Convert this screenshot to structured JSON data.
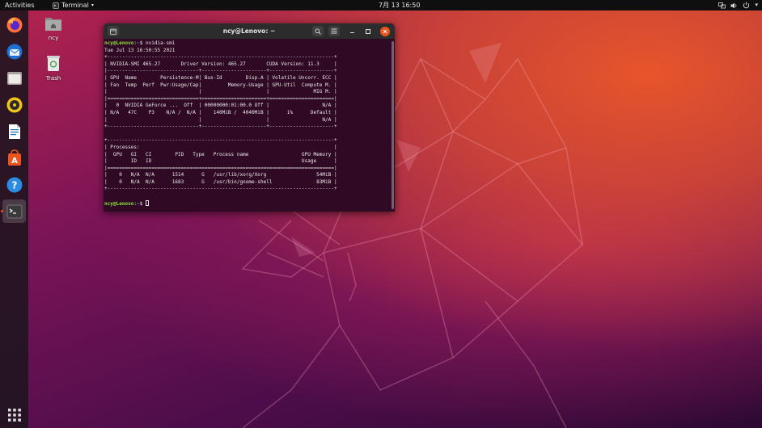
{
  "topbar": {
    "activities": "Activities",
    "app_menu": "Terminal",
    "clock": "7月 13  16:50"
  },
  "dock": {
    "items": [
      "firefox-icon",
      "thunderbird-icon",
      "files-icon",
      "rhythmbox-icon",
      "libreoffice-writer-icon",
      "ubuntu-software-icon",
      "help-icon",
      "terminal-icon"
    ]
  },
  "desktop": {
    "home_label": "ncy",
    "trash_label": "Trash"
  },
  "terminal": {
    "title": "ncy@Lenovo: ~",
    "prompt_user": "ncy@Lenovo",
    "prompt_path": "~",
    "command": "nvidia-smi",
    "output": "Tue Jul 13 16:50:55 2021       \n+-----------------------------------------------------------------------------+\n| NVIDIA-SMI 465.27       Driver Version: 465.27       CUDA Version: 11.3     |\n|-------------------------------+----------------------+----------------------+\n| GPU  Name        Persistence-M| Bus-Id        Disp.A | Volatile Uncorr. ECC |\n| Fan  Temp  Perf  Pwr:Usage/Cap|         Memory-Usage | GPU-Util  Compute M. |\n|                               |                      |               MIG M. |\n|===============================+======================+======================|\n|   0  NVIDIA GeForce ...  Off  | 00000000:01:00.0 Off |                  N/A |\n| N/A   47C    P3    N/A /  N/A |    140MiB /  4040MiB |      1%      Default |\n|                               |                      |                  N/A |\n+-------------------------------+----------------------+----------------------+\n                                                                               \n+-----------------------------------------------------------------------------+\n| Processes:                                                                  |\n|  GPU   GI   CI        PID   Type   Process name                  GPU Memory |\n|        ID   ID                                                   Usage      |\n|=============================================================================|\n|    0   N/A  N/A      1514      G   /usr/lib/xorg/Xorg                 54MiB |\n|    0   N/A  N/A      1683      G   /usr/bin/gnome-shell               83MiB |\n+-----------------------------------------------------------------------------+"
  }
}
